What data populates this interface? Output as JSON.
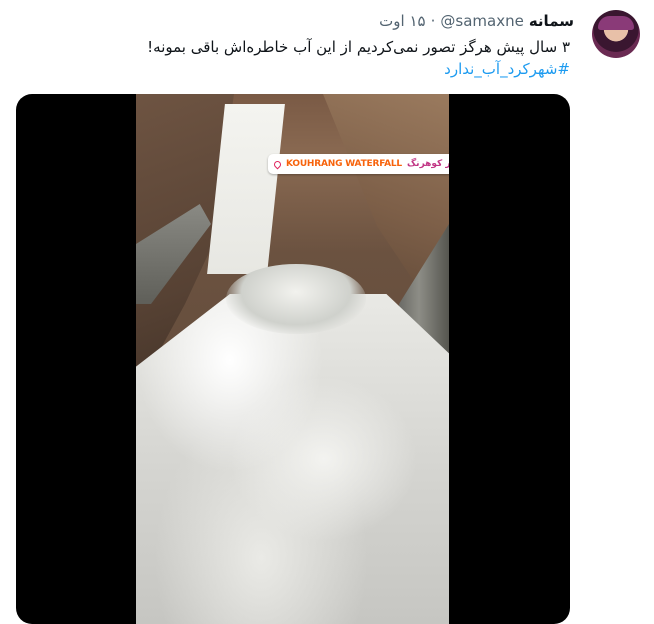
{
  "tweet": {
    "author": {
      "display_name": "سمانه",
      "handle": "@samaxne",
      "separator": "·",
      "date": "۱۵ اوت"
    },
    "text": "۳ سال پیش هرگز تصور نمی‌کردیم از این آب خاطره‌اش باقی بمونه!",
    "hashtag": "#شهرکرد_آب_ندارد",
    "media": {
      "sticker_en": "KOUHRANG WATERFALL",
      "sticker_fa": "آبشار کوهرنگ"
    }
  },
  "colors": {
    "link": "#1d9bf0",
    "secondary_text": "#536471",
    "primary_text": "#0f1419",
    "sticker_orange": "#f7630c",
    "sticker_pink": "#c13584"
  },
  "icons": {
    "location": "location-pin-icon",
    "avatar": "profile-photo"
  }
}
